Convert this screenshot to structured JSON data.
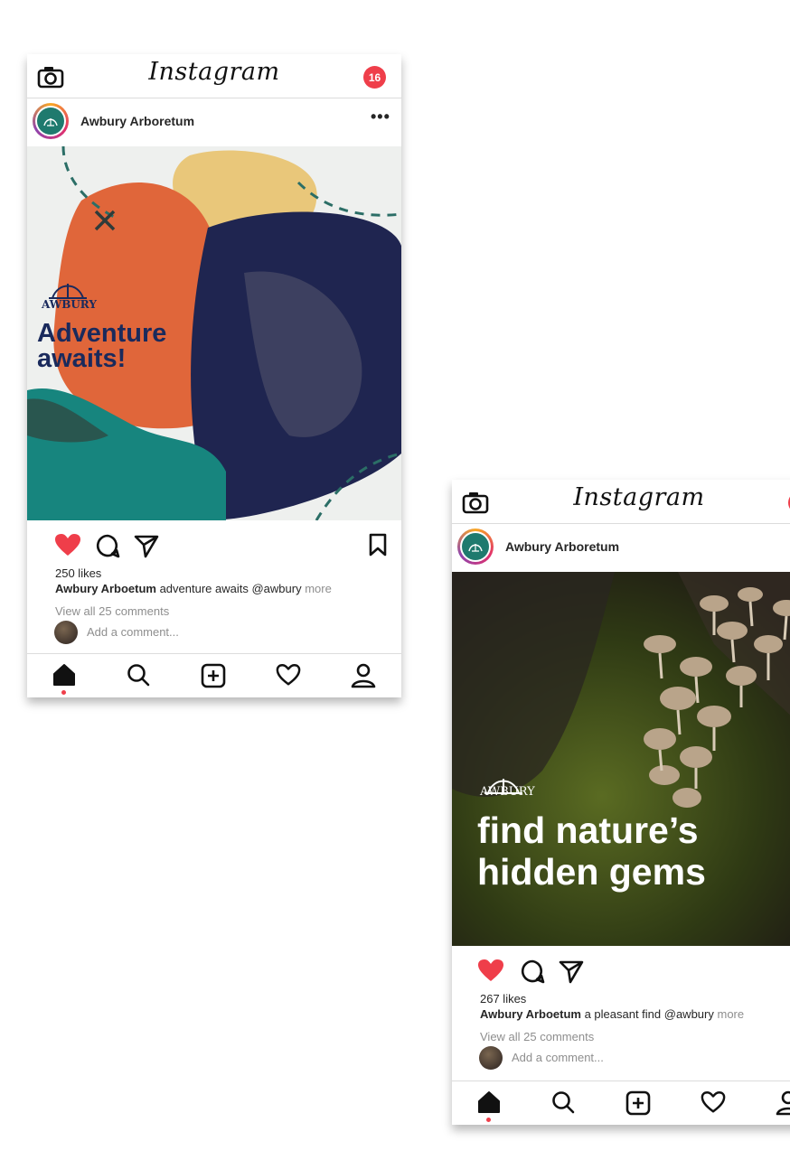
{
  "app_name": "Instagram",
  "notification_count": "16",
  "posts": [
    {
      "username": "Awbury Arboretum",
      "more_menu": "•••",
      "photo_brand": "AWBURY",
      "photo_headline_1": "Adventure",
      "photo_headline_2": "awaits!",
      "likes": "250 likes",
      "caption_user": "Awbury Arboetum",
      "caption_text": " adventure awaits @awbury ",
      "caption_more": "more",
      "view_comments": "View all 25 comments",
      "add_comment_placeholder": "Add a comment..."
    },
    {
      "username": "Awbury Arboretum",
      "photo_brand": "AWBURY",
      "photo_headline_1": "find nature’s",
      "photo_headline_2": "hidden gems",
      "likes": "267 likes",
      "caption_user": "Awbury Arboetum",
      "caption_text": " a pleasant find @awbury ",
      "caption_more": "more",
      "view_comments": "View all 25 comments",
      "add_comment_placeholder": "Add a comment..."
    }
  ],
  "icons": {
    "camera": "camera-icon",
    "like": "heart-filled-icon",
    "comment": "comment-icon",
    "share": "send-icon",
    "save": "bookmark-icon",
    "home": "home-icon",
    "search": "search-icon",
    "new_post": "plus-square-icon",
    "activity": "heart-outline-icon",
    "profile": "profile-icon"
  },
  "colors": {
    "like_red": "#ef3e4a",
    "brand_teal": "#1f7a6e",
    "headline_navy": "#1a2a5c"
  }
}
